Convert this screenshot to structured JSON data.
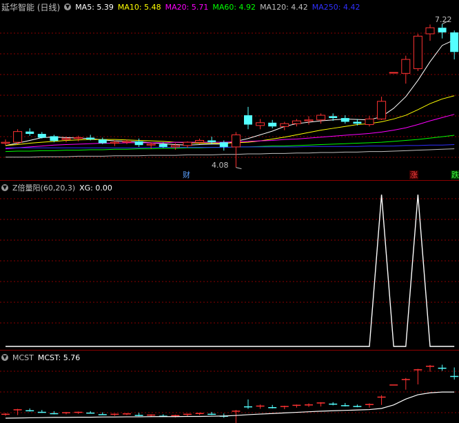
{
  "main_panel": {
    "title": "延华智能 (日线)",
    "ma": [
      {
        "label": "MA5: 5.39",
        "color": "#ffffff"
      },
      {
        "label": "MA10: 5.48",
        "color": "#ffff00"
      },
      {
        "label": "MA20: 5.71",
        "color": "#ff00ff"
      },
      {
        "label": "MA60: 4.92",
        "color": "#00ff00"
      },
      {
        "label": "MA120: 4.42",
        "color": "#c0c0c0"
      },
      {
        "label": "MA250: 4.42",
        "color": "#3030ff"
      }
    ],
    "high_label": "7.22",
    "low_label": "4.08",
    "tags": {
      "cai": "财",
      "zhang": "涨",
      "die": "跌"
    }
  },
  "indicator_panel": {
    "title": "Z倍量阳(60,20,3)",
    "xg": "XG: 0.00"
  },
  "mcst_panel": {
    "title": "MCST",
    "value": "MCST: 5.76"
  },
  "colors": {
    "up": "#ff3232",
    "down": "#54ffff",
    "grid": "#8b0000"
  },
  "candles": [
    [
      4.6,
      4.68,
      4.55,
      4.62
    ],
    [
      4.62,
      4.9,
      4.58,
      4.85
    ],
    [
      4.85,
      4.92,
      4.76,
      4.8
    ],
    [
      4.8,
      4.84,
      4.7,
      4.72
    ],
    [
      4.75,
      4.78,
      4.62,
      4.65
    ],
    [
      4.68,
      4.74,
      4.62,
      4.7
    ],
    [
      4.7,
      4.76,
      4.64,
      4.72
    ],
    [
      4.72,
      4.78,
      4.66,
      4.68
    ],
    [
      4.68,
      4.72,
      4.58,
      4.6
    ],
    [
      4.6,
      4.66,
      4.54,
      4.62
    ],
    [
      4.62,
      4.68,
      4.58,
      4.64
    ],
    [
      4.64,
      4.7,
      4.52,
      4.56
    ],
    [
      4.56,
      4.62,
      4.48,
      4.58
    ],
    [
      4.58,
      4.62,
      4.5,
      4.52
    ],
    [
      4.52,
      4.6,
      4.46,
      4.55
    ],
    [
      4.55,
      4.64,
      4.5,
      4.62
    ],
    [
      4.62,
      4.7,
      4.58,
      4.66
    ],
    [
      4.66,
      4.74,
      4.58,
      4.62
    ],
    [
      4.62,
      4.66,
      4.44,
      4.52
    ],
    [
      4.52,
      4.84,
      4.08,
      4.78
    ],
    [
      5.2,
      5.38,
      4.9,
      5.0
    ],
    [
      4.98,
      5.12,
      4.9,
      5.04
    ],
    [
      5.04,
      5.1,
      4.92,
      4.96
    ],
    [
      4.96,
      5.06,
      4.88,
      5.02
    ],
    [
      5.02,
      5.12,
      4.96,
      5.08
    ],
    [
      5.08,
      5.18,
      5.0,
      5.1
    ],
    [
      5.1,
      5.24,
      5.02,
      5.2
    ],
    [
      5.18,
      5.24,
      5.08,
      5.14
    ],
    [
      5.14,
      5.2,
      5.02,
      5.06
    ],
    [
      5.06,
      5.12,
      4.98,
      5.02
    ],
    [
      5.0,
      5.18,
      4.96,
      5.12
    ],
    [
      5.12,
      5.6,
      5.1,
      5.5
    ],
    [
      6.12,
      6.12,
      6.12,
      6.12
    ],
    [
      6.1,
      6.48,
      5.88,
      6.4
    ],
    [
      6.2,
      6.95,
      6.15,
      6.9
    ],
    [
      6.95,
      7.15,
      6.8,
      7.08
    ],
    [
      7.08,
      7.16,
      6.85,
      6.98
    ],
    [
      6.98,
      7.02,
      6.4,
      6.56
    ]
  ],
  "ma_lines": {
    "ma5": [
      4.55,
      4.6,
      4.66,
      4.72,
      4.73,
      4.72,
      4.71,
      4.7,
      4.67,
      4.65,
      4.64,
      4.63,
      4.61,
      4.59,
      4.57,
      4.56,
      4.57,
      4.58,
      4.58,
      4.64,
      4.7,
      4.78,
      4.86,
      4.96,
      5.02,
      5.05,
      5.08,
      5.1,
      5.12,
      5.11,
      5.1,
      5.17,
      5.35,
      5.6,
      5.95,
      6.35,
      6.7,
      6.82
    ],
    "ma10": [
      4.55,
      4.57,
      4.6,
      4.62,
      4.64,
      4.66,
      4.67,
      4.68,
      4.68,
      4.68,
      4.67,
      4.66,
      4.65,
      4.64,
      4.62,
      4.61,
      4.6,
      4.6,
      4.6,
      4.61,
      4.62,
      4.65,
      4.69,
      4.73,
      4.78,
      4.83,
      4.88,
      4.92,
      4.96,
      5.0,
      5.02,
      5.06,
      5.12,
      5.2,
      5.32,
      5.45,
      5.55,
      5.62
    ],
    "ma20": [
      4.48,
      4.5,
      4.52,
      4.54,
      4.56,
      4.57,
      4.58,
      4.59,
      4.6,
      4.6,
      4.61,
      4.61,
      4.61,
      4.61,
      4.62,
      4.62,
      4.62,
      4.62,
      4.62,
      4.63,
      4.64,
      4.65,
      4.66,
      4.68,
      4.69,
      4.71,
      4.73,
      4.75,
      4.77,
      4.79,
      4.81,
      4.84,
      4.88,
      4.93,
      5.0,
      5.08,
      5.15,
      5.22
    ],
    "ma60": [
      4.42,
      4.43,
      4.43,
      4.44,
      4.44,
      4.45,
      4.45,
      4.46,
      4.46,
      4.47,
      4.47,
      4.48,
      4.48,
      4.49,
      4.49,
      4.5,
      4.5,
      4.51,
      4.51,
      4.52,
      4.52,
      4.53,
      4.54,
      4.54,
      4.55,
      4.56,
      4.57,
      4.58,
      4.59,
      4.6,
      4.61,
      4.62,
      4.64,
      4.66,
      4.68,
      4.71,
      4.74,
      4.77
    ],
    "ma120": [
      4.3,
      4.3,
      4.3,
      4.31,
      4.31,
      4.31,
      4.32,
      4.32,
      4.32,
      4.33,
      4.33,
      4.33,
      4.34,
      4.34,
      4.34,
      4.35,
      4.35,
      4.35,
      4.36,
      4.36,
      4.37,
      4.37,
      4.38,
      4.38,
      4.39,
      4.39,
      4.4,
      4.4,
      4.41,
      4.41,
      4.42,
      4.42,
      4.43,
      4.44,
      4.45,
      4.46,
      4.47,
      4.48
    ],
    "ma250": [
      4.5,
      4.5,
      4.5,
      4.5,
      4.5,
      4.5,
      4.5,
      4.5,
      4.5,
      4.5,
      4.5,
      4.5,
      4.51,
      4.51,
      4.51,
      4.51,
      4.51,
      4.51,
      4.51,
      4.52,
      4.52,
      4.52,
      4.52,
      4.52,
      4.52,
      4.53,
      4.53,
      4.53,
      4.53,
      4.53,
      4.54,
      4.54,
      4.54,
      4.55,
      4.55,
      4.56,
      4.56,
      4.57
    ]
  },
  "xg_signal": [
    0,
    0,
    0,
    0,
    0,
    0,
    0,
    0,
    0,
    0,
    0,
    0,
    0,
    0,
    0,
    0,
    0,
    0,
    0,
    0,
    0,
    0,
    0,
    0,
    0,
    0,
    0,
    0,
    0,
    0,
    0,
    1,
    0,
    0,
    1,
    0,
    0,
    0
  ],
  "mcst_line": [
    4.42,
    4.43,
    4.44,
    4.45,
    4.46,
    4.46,
    4.47,
    4.47,
    4.48,
    4.48,
    4.49,
    4.49,
    4.5,
    4.5,
    4.5,
    4.51,
    4.51,
    4.52,
    4.53,
    4.56,
    4.6,
    4.63,
    4.66,
    4.69,
    4.72,
    4.75,
    4.78,
    4.8,
    4.82,
    4.84,
    4.86,
    4.92,
    5.1,
    5.4,
    5.62,
    5.72,
    5.76,
    5.76
  ]
}
